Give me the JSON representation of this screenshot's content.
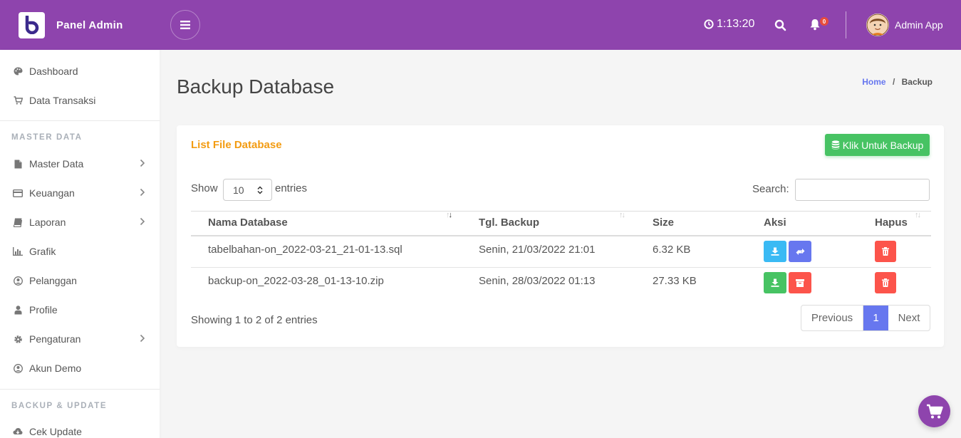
{
  "header": {
    "brand": "Panel Admin",
    "time": "1:13:20",
    "notification_count": "0",
    "user_name": "Admin App"
  },
  "sidebar": {
    "items_top": [
      {
        "label": "Dashboard",
        "icon": "palette-icon"
      },
      {
        "label": "Data Transaksi",
        "icon": "cart-icon"
      }
    ],
    "section_master": "MASTER DATA",
    "items_master": [
      {
        "label": "Master Data",
        "icon": "file-icon",
        "submenu": true
      },
      {
        "label": "Keuangan",
        "icon": "credit-card-icon",
        "submenu": true
      },
      {
        "label": "Laporan",
        "icon": "book-icon",
        "submenu": true
      },
      {
        "label": "Grafik",
        "icon": "bar-chart-icon",
        "submenu": false
      },
      {
        "label": "Pelanggan",
        "icon": "user-circle-icon",
        "submenu": false
      },
      {
        "label": "Profile",
        "icon": "user-icon",
        "submenu": false
      },
      {
        "label": "Pengaturan",
        "icon": "gear-icon",
        "submenu": true
      },
      {
        "label": "Akun Demo",
        "icon": "user-circle-icon",
        "submenu": false
      }
    ],
    "section_backup": "BACKUP & UPDATE",
    "items_backup": [
      {
        "label": "Cek Update",
        "icon": "cloud-download-icon"
      }
    ]
  },
  "page": {
    "title": "Backup Database",
    "breadcrumb": {
      "home": "Home",
      "separator": "/",
      "current": "Backup"
    }
  },
  "card": {
    "title": "List File Database",
    "backup_button": "Klik Untuk Backup",
    "show_label": "Show",
    "page_length": "10",
    "entries_label": "entries",
    "search_label": "Search:",
    "search_value": "",
    "columns": [
      "Nama Database",
      "Tgl. Backup",
      "Size",
      "Aksi",
      "Hapus"
    ],
    "rows": [
      {
        "name": "tabelbahan-on_2022-03-21_21-01-13.sql",
        "date": "Senin, 21/03/2022 21:01",
        "size": "6.32 KB",
        "type": "sql"
      },
      {
        "name": "backup-on_2022-03-28_01-13-10.zip",
        "date": "Senin, 28/03/2022 01:13",
        "size": "27.33 KB",
        "type": "zip"
      }
    ],
    "info": "Showing 1 to 2 of 2 entries",
    "pagination": {
      "previous": "Previous",
      "current": "1",
      "next": "Next"
    }
  },
  "colors": {
    "header": "#8e44ad",
    "accent": "#6777ef",
    "card_title": "#f39c12",
    "success": "#47c363",
    "danger": "#fc544b",
    "info": "#3abaf4"
  }
}
